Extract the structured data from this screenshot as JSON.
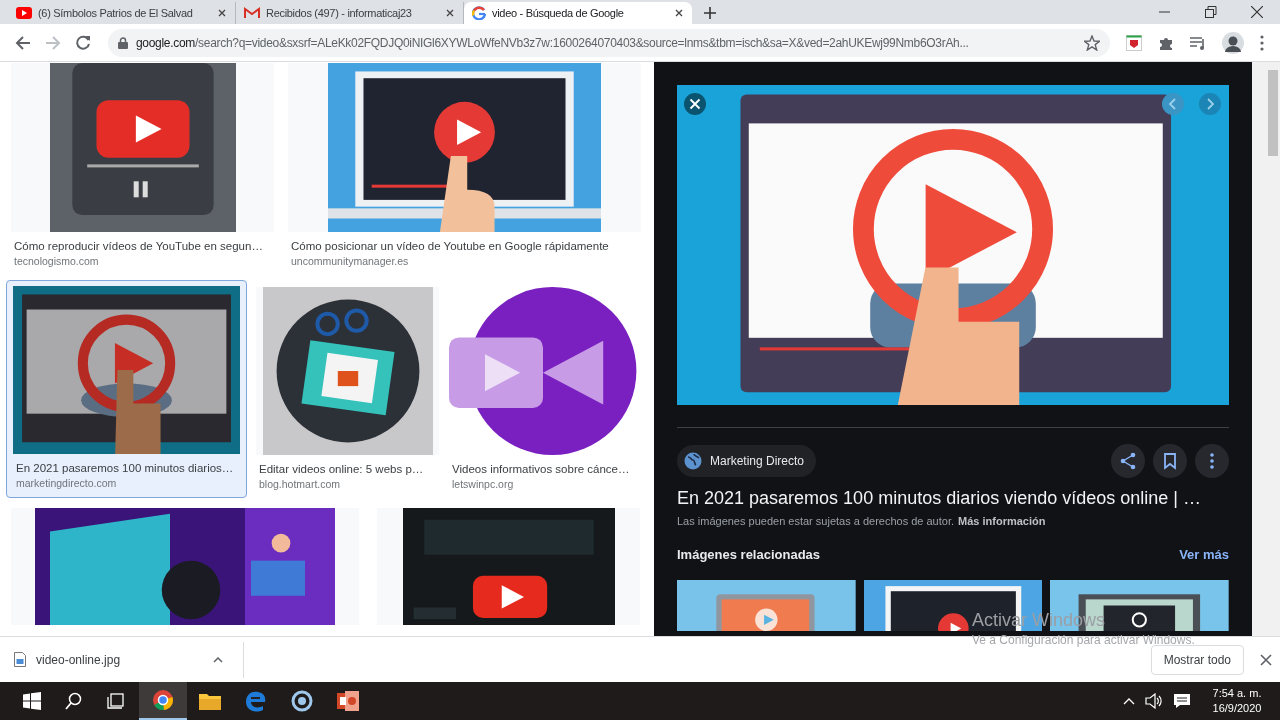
{
  "browser": {
    "tabs": [
      {
        "title": "(6) Símbolos Patrios de El Salvad",
        "selected": false
      },
      {
        "title": "Recibidos (497) - informaticaj23",
        "selected": false
      },
      {
        "title": "video - Búsqueda de Google",
        "selected": true
      }
    ],
    "url_host": "google.com",
    "url_path": "/search?q=video&sxsrf=ALeKk02FQDJQ0iNIGl6XYWLoWfeNVb3z7w:1600264070403&source=lnms&tbm=isch&sa=X&ved=2ahUKEwj99Nmb6O3rAh..."
  },
  "results": {
    "rows": [
      {
        "items": [
          {
            "caption": "Cómo reproducir vídeos de YouTube en segun…",
            "source": "tecnologismo.com",
            "selected": false
          },
          {
            "caption": "Cómo posicionar un vídeo de Youtube en Google rápidamente",
            "source": "uncommunitymanager.es",
            "selected": false
          }
        ]
      },
      {
        "items": [
          {
            "caption": "En 2021 pasaremos 100 minutos diarios…",
            "source": "marketingdirecto.com",
            "selected": true
          },
          {
            "caption": "Editar videos online: 5 webs p…",
            "source": "blog.hotmart.com",
            "selected": false
          },
          {
            "caption": "Videos informativos sobre cánce…",
            "source": "letswinpc.org",
            "selected": false
          }
        ]
      },
      {
        "items": [
          {
            "selected": false
          },
          {
            "selected": false
          }
        ]
      }
    ]
  },
  "preview": {
    "source": "Marketing Directo",
    "title": "En 2021 pasaremos 100 minutos diarios viendo vídeos online | …",
    "notice": "Las imágenes pueden estar sujetas a derechos de autor.",
    "more_info": "Más información",
    "related_heading": "Imágenes relacionadas",
    "see_more": "Ver más"
  },
  "activation": {
    "heading": "Activar Windows",
    "hint": "Ve a Configuración para activar Windows."
  },
  "download": {
    "file": "video-online.jpg",
    "show_all": "Mostrar todo"
  },
  "taskbar": {
    "time": "7:54 a. m.",
    "date": "16/9/2020"
  }
}
